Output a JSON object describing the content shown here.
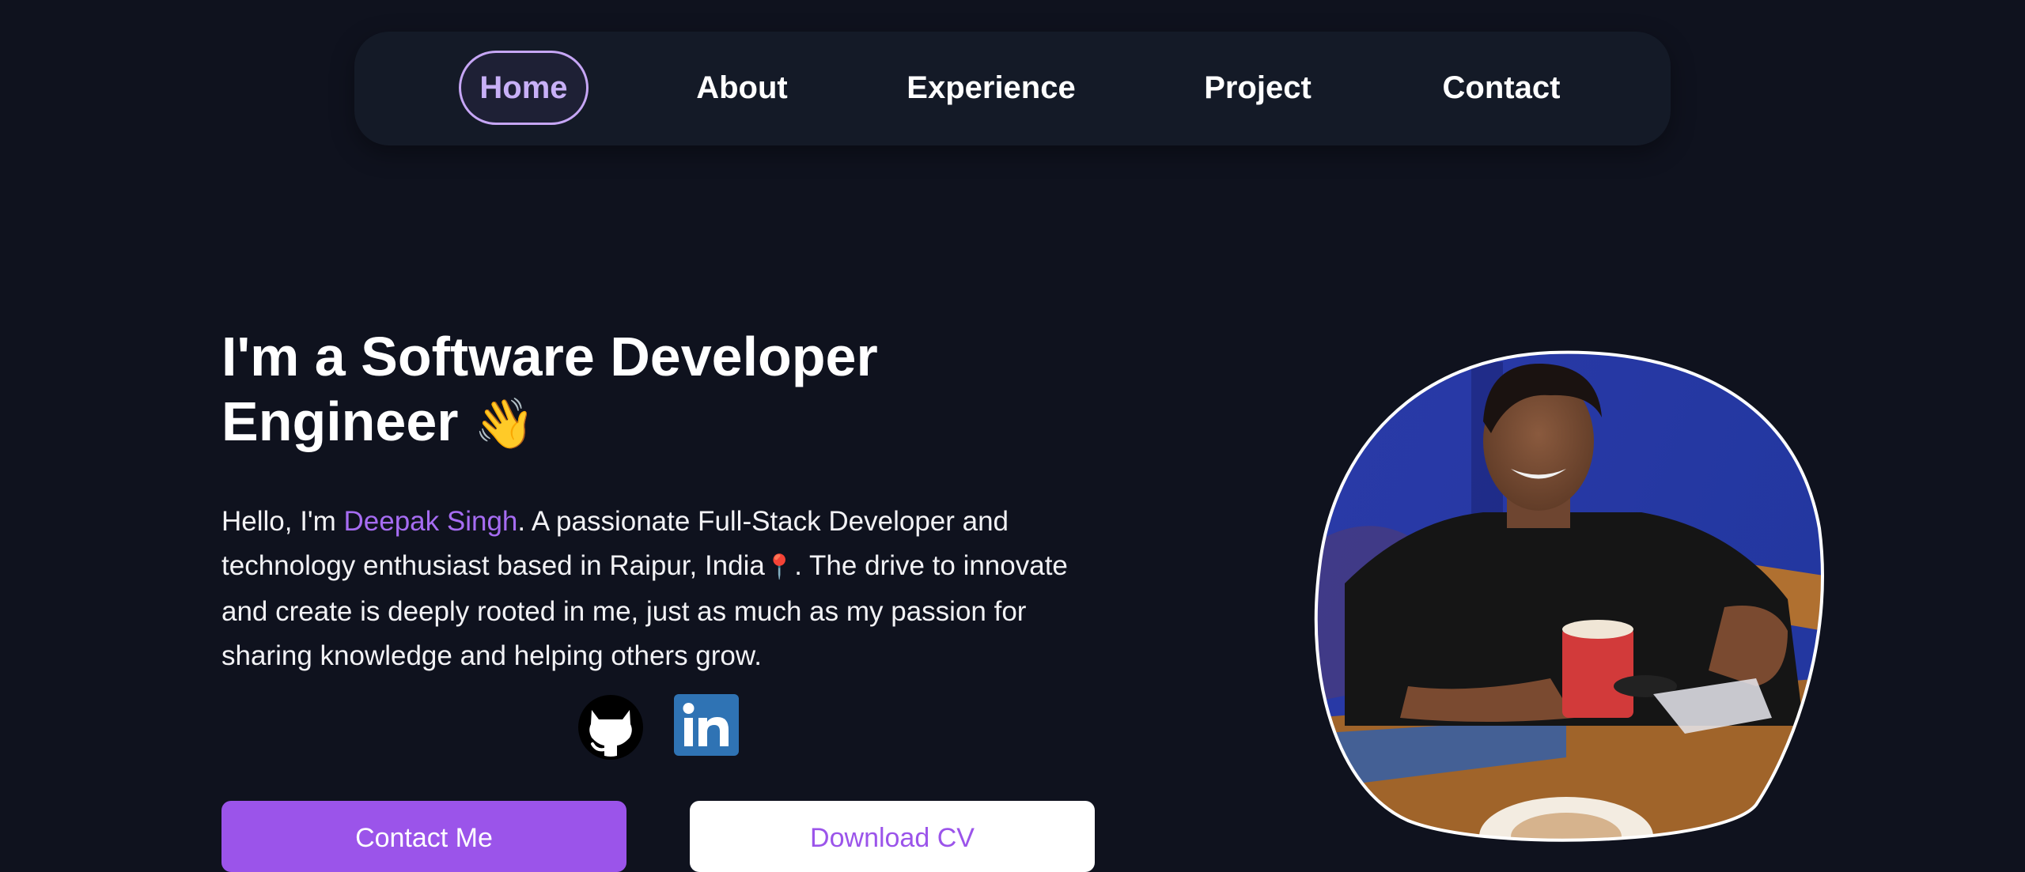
{
  "nav": {
    "items": [
      {
        "label": "Home",
        "active": true
      },
      {
        "label": "About"
      },
      {
        "label": "Experience"
      },
      {
        "label": "Project"
      },
      {
        "label": "Contact"
      }
    ]
  },
  "hero": {
    "title_line1": "I'm a Software Developer",
    "title_line2": "Engineer",
    "wave_emoji": "👋",
    "intro_prefix": "Hello, I'm ",
    "name": "Deepak Singh",
    "intro_part2": ". A passionate Full-Stack Developer and technology enthusiast based in Raipur, India",
    "pin_emoji": "📍",
    "intro_part3": ". The drive to innovate and create is deeply rooted in me, just as much as my passion for sharing knowledge and helping others grow."
  },
  "social": {
    "github_icon": "github-icon",
    "linkedin_icon": "linkedin-icon"
  },
  "buttons": {
    "contact_label": "Contact Me",
    "cv_label": "Download CV"
  },
  "colors": {
    "background": "#0f121e",
    "navbar": "#141a27",
    "accent": "#9b54ea",
    "active_border": "#c6a6f5",
    "linkedin": "#2f73b4"
  }
}
